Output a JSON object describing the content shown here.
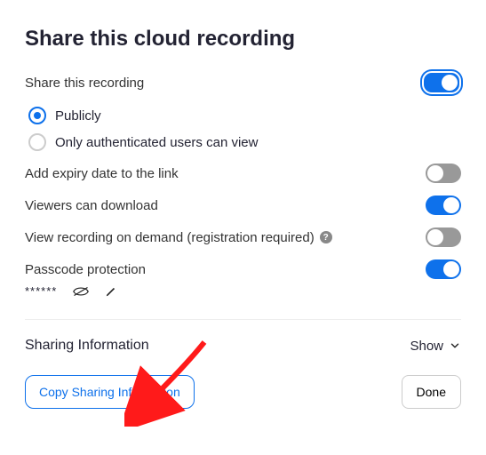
{
  "title": "Share this cloud recording",
  "share_recording": {
    "label": "Share this recording",
    "on": true
  },
  "visibility": {
    "publicly": "Publicly",
    "authenticated": "Only authenticated users can view",
    "selected": "publicly"
  },
  "expiry": {
    "label": "Add expiry date to the link",
    "on": false
  },
  "download": {
    "label": "Viewers can download",
    "on": true
  },
  "ondemand": {
    "label": "View recording on demand (registration required)",
    "on": false
  },
  "passcode": {
    "label": "Passcode protection",
    "on": true,
    "masked": "******"
  },
  "sharing_info": {
    "label": "Sharing Information",
    "toggle": "Show"
  },
  "buttons": {
    "copy": "Copy Sharing Information",
    "done": "Done"
  }
}
